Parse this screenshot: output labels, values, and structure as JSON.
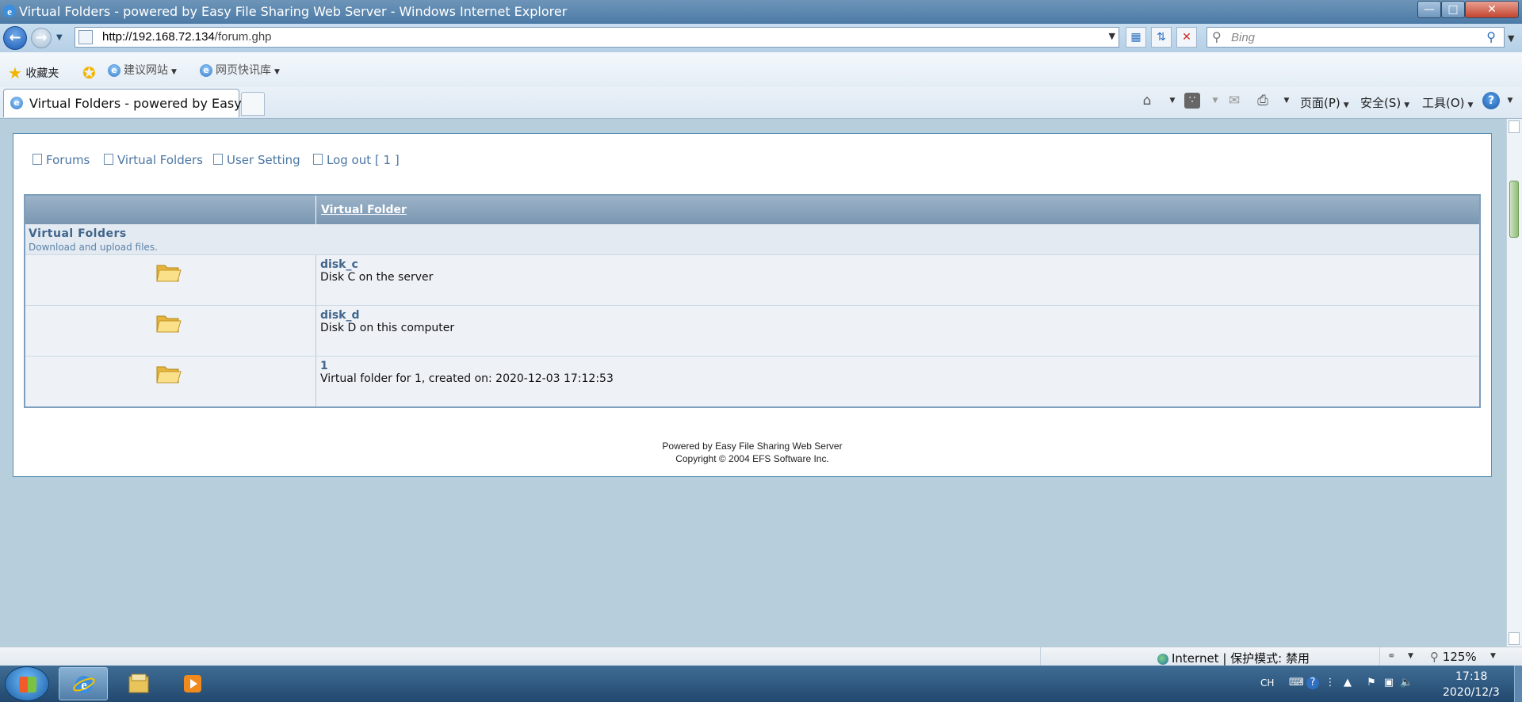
{
  "window": {
    "title": "Virtual Folders - powered by Easy File Sharing Web Server - Windows Internet Explorer",
    "min": "—",
    "max": "□",
    "close": "✕"
  },
  "addressbar": {
    "url_host": "http://192.168.72.134",
    "url_path": "/forum.ghp",
    "search_placeholder": "Bing"
  },
  "favorites": {
    "label": "收藏夹",
    "items": [
      {
        "label": "建议网站"
      },
      {
        "label": "网页快讯库"
      }
    ]
  },
  "tab": {
    "active_label": "Virtual Folders - powered by Easy ..."
  },
  "commandbar": {
    "page": "页面(P)",
    "safety": "安全(S)",
    "tools": "工具(O)"
  },
  "page": {
    "nav": [
      {
        "label": "Forums"
      },
      {
        "label": "Virtual Folders"
      },
      {
        "label": "User Setting"
      },
      {
        "label": "Log out [ 1 ]"
      }
    ],
    "table": {
      "column_header": "Virtual Folder",
      "category_title": "Virtual Folders",
      "category_desc": "Download and upload files.",
      "rows": [
        {
          "name": "disk_c",
          "desc": "Disk C on the server"
        },
        {
          "name": "disk_d",
          "desc": "Disk D on this computer"
        },
        {
          "name": "1",
          "desc": "Virtual folder for 1, created on: 2020-12-03 17:12:53"
        }
      ]
    },
    "footer_line1": "Powered by Easy File Sharing Web Server",
    "footer_line2": "Copyright © 2004 EFS Software Inc."
  },
  "status": {
    "zone": "Internet | 保护模式: 禁用",
    "zoom": "125%"
  },
  "taskbar": {
    "lang": "CH",
    "time": "17:18",
    "date": "2020/12/3"
  },
  "colors": {
    "link": "#4a76a2",
    "header_bg": "#7a96b1",
    "page_bg": "#b7cfdd"
  }
}
